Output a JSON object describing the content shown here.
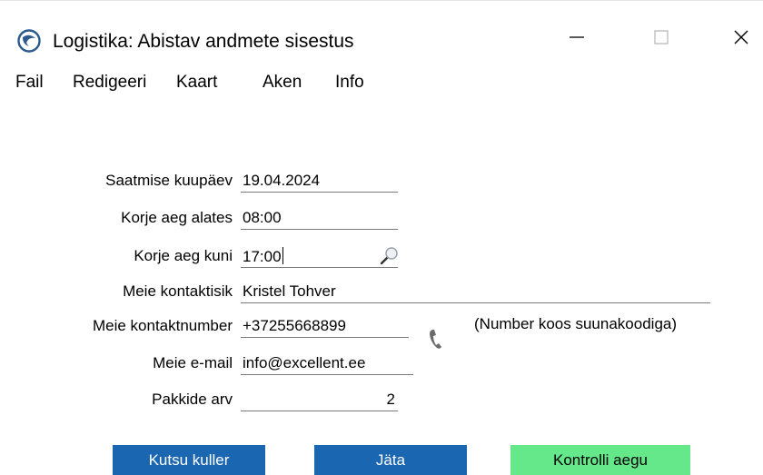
{
  "window": {
    "title": "Logistika: Abistav andmete sisestus",
    "controls": [
      "minimize-icon",
      "maximize-icon",
      "close-icon"
    ]
  },
  "menu": {
    "items": [
      "Fail",
      "Redigeeri",
      "Kaart",
      "Aken",
      "Info"
    ]
  },
  "form": {
    "fields": [
      {
        "label": "Saatmise kuupäev",
        "value": "19.04.2024"
      },
      {
        "label": "Korje aeg alates",
        "value": "08:00"
      },
      {
        "label": "Korje aeg kuni",
        "value": "17:00"
      },
      {
        "label": "Meie kontaktisik",
        "value": "Kristel Tohver"
      },
      {
        "label": "Meie kontaktnumber",
        "value": "+37255668899"
      },
      {
        "label": "Meie e-mail",
        "value": "info@excellent.ee"
      },
      {
        "label": "Pakkide arv",
        "value": "2"
      }
    ],
    "phone_note": "(Number koos suunakoodiga)",
    "icons": {
      "pickup_end_lookup": "magnifier-icon",
      "contact_number": "phone-icon"
    }
  },
  "buttons": {
    "call_courier": "Kutsu kuller",
    "skip": "Jäta",
    "check_times": "Kontrolli aegu"
  },
  "colors": {
    "primary_button": "#1b66b0",
    "success_button": "#65e88a",
    "field_underline": "#7a7a7a"
  }
}
